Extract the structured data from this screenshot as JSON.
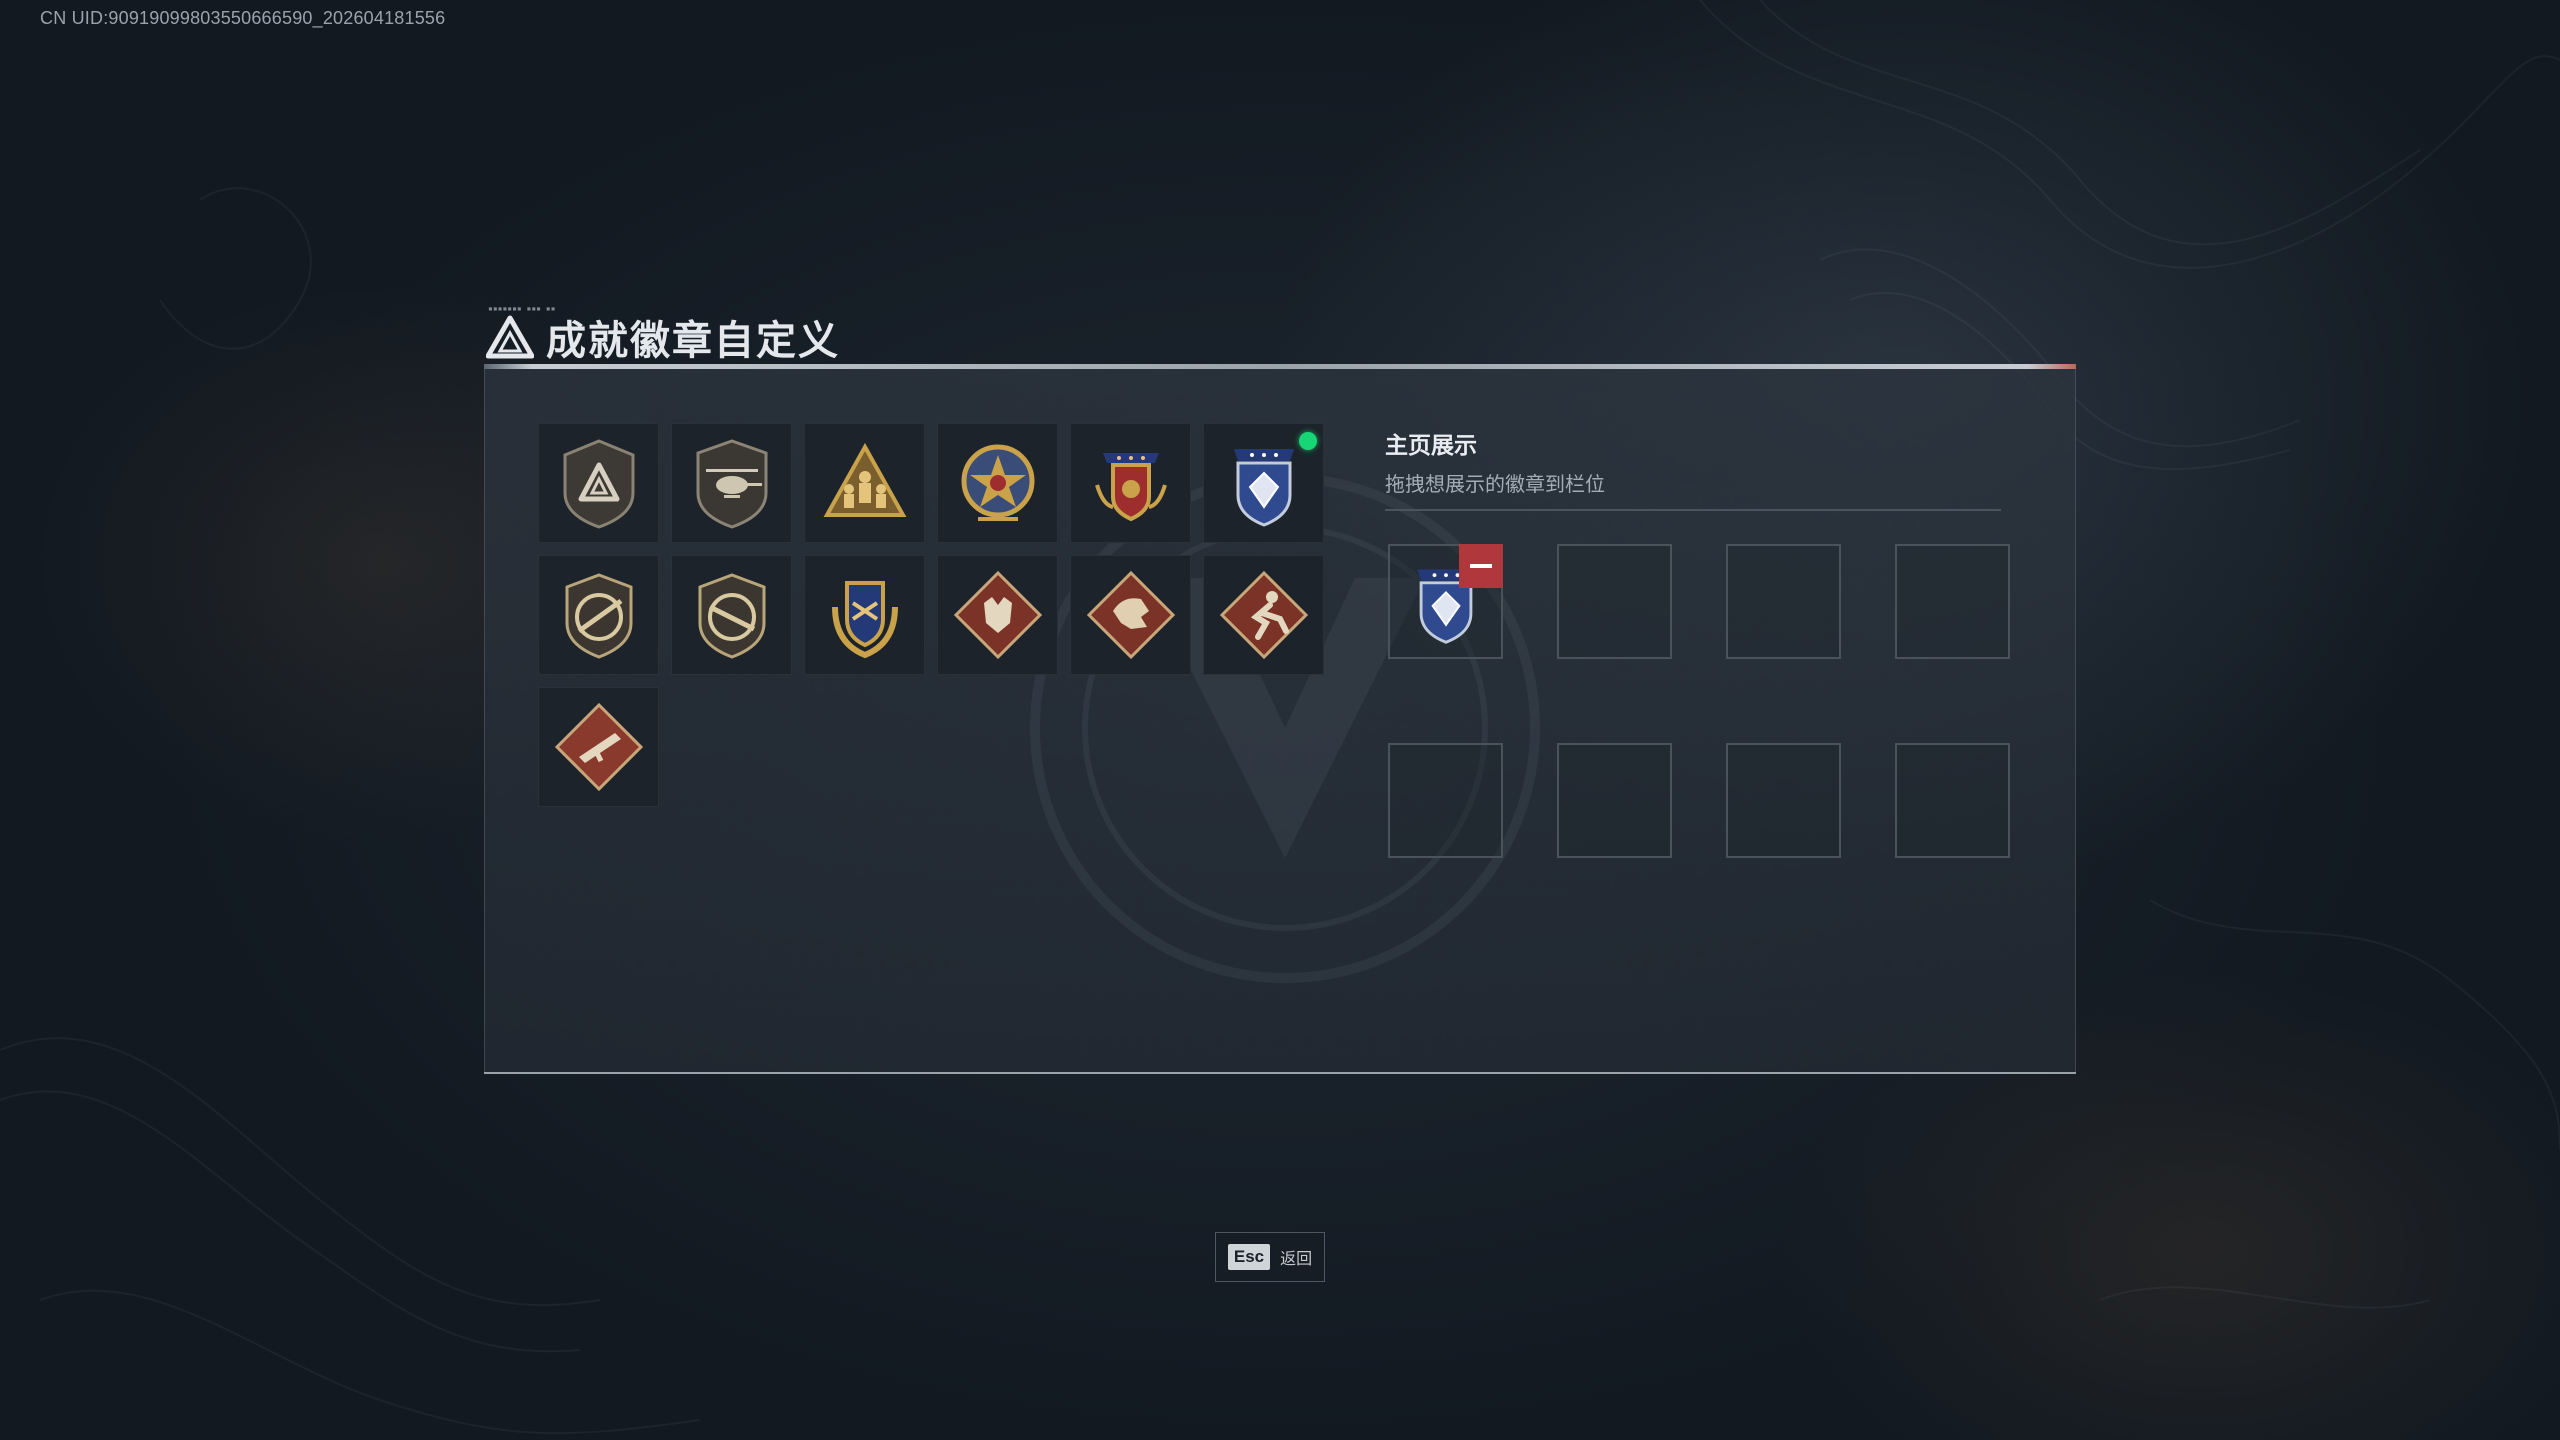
{
  "uid_text": "CN UID:90919099803550666590_202604181556",
  "panel": {
    "title": "成就徽章自定义",
    "logo_icon": "delta-triangle-logo-icon"
  },
  "badges": [
    {
      "icon": "delta-triangle-shield-badge-icon",
      "equipped": false
    },
    {
      "icon": "helicopter-shield-badge-icon",
      "equipped": false
    },
    {
      "icon": "soldiers-triangle-badge-icon",
      "equipped": false
    },
    {
      "icon": "star-crest-badge-icon",
      "equipped": false
    },
    {
      "icon": "winged-star-crest-badge-icon",
      "equipped": false
    },
    {
      "icon": "blue-diamond-shield-badge-icon",
      "equipped": true
    },
    {
      "icon": "rifle-shield-badge-icon",
      "equipped": false
    },
    {
      "icon": "rifle-shield-badge-2-icon",
      "equipped": false
    },
    {
      "icon": "gold-laurel-shield-badge-icon",
      "equipped": false
    },
    {
      "icon": "wolf-diamond-badge-icon",
      "equipped": false
    },
    {
      "icon": "dragon-diamond-badge-icon",
      "equipped": false
    },
    {
      "icon": "runner-diamond-badge-icon",
      "equipped": false
    },
    {
      "icon": "weapon-diamond-badge-icon",
      "equipped": false
    }
  ],
  "showcase": {
    "title": "主页展示",
    "subtitle": "拖拽想展示的徽章到栏位",
    "slots": [
      {
        "badge": "blue-diamond-shield-badge-icon"
      },
      {
        "badge": null
      },
      {
        "badge": null
      },
      {
        "badge": null
      },
      {
        "badge": null
      },
      {
        "badge": null
      },
      {
        "badge": null
      },
      {
        "badge": null
      }
    ]
  },
  "esc": {
    "key": "Esc",
    "label": "返回"
  },
  "colors": {
    "equipped_dot": "#17d675",
    "remove_button": "#b0373c",
    "gold": "#c9a24a",
    "bronze_red": "#7a3326",
    "navy": "#243a78"
  }
}
